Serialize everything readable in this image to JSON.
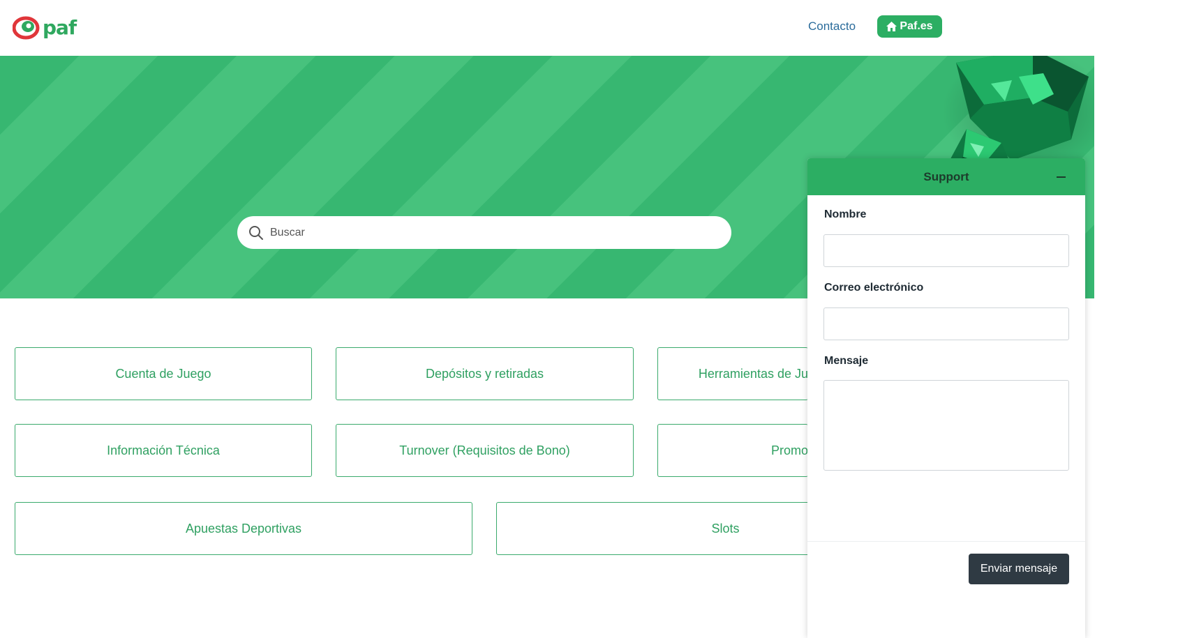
{
  "header": {
    "logo_text": "paf",
    "nav": {
      "contact_label": "Contacto",
      "paf_label": "Paf.es"
    }
  },
  "hero": {
    "search_placeholder": "Buscar"
  },
  "categories": [
    {
      "label": "Cuenta de Juego"
    },
    {
      "label": "Depósitos y retiradas"
    },
    {
      "label": "Herramientas de Ju"
    },
    {
      "label": "Información Técnica"
    },
    {
      "label": "Turnover (Requisitos de Bono)"
    },
    {
      "label": "Promo"
    },
    {
      "label": "Apuestas Deportivas"
    },
    {
      "label": "Slots"
    }
  ],
  "support": {
    "title": "Support",
    "name_label": "Nombre",
    "name_value": "",
    "email_label": "Correo electrónico",
    "email_value": "",
    "message_label": "Mensaje",
    "message_value": "",
    "send_label": "Enviar mensaje"
  },
  "colors": {
    "brand_green": "#2cae63",
    "link_blue": "#2b6c9b",
    "send_button": "#2f3a43"
  }
}
